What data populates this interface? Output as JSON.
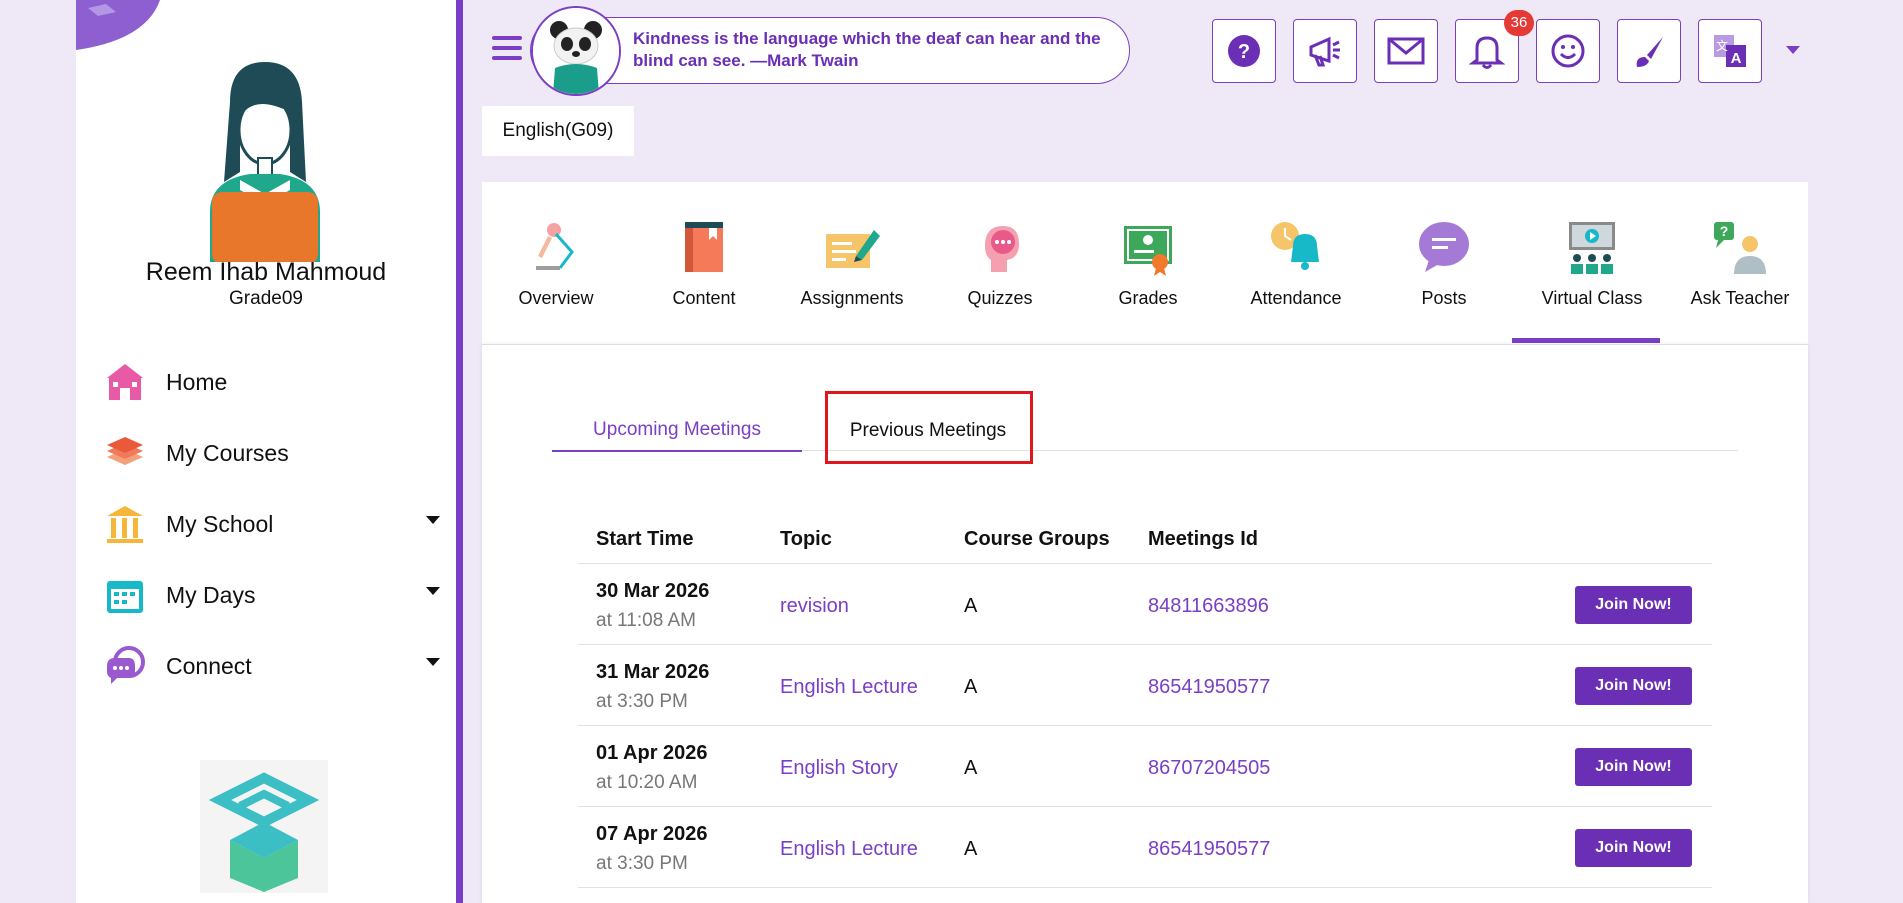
{
  "user": {
    "name": "Reem Ihab Mahmoud",
    "grade": "Grade09"
  },
  "sidebar": {
    "items": [
      {
        "label": "Home",
        "icon": "home-icon",
        "color": "#e85aa6",
        "has_caret": false
      },
      {
        "label": "My Courses",
        "icon": "courses-icon",
        "color": "#f07a5a",
        "has_caret": false
      },
      {
        "label": "My School",
        "icon": "school-icon",
        "color": "#f5b63a",
        "has_caret": true
      },
      {
        "label": "My Days",
        "icon": "calendar-icon",
        "color": "#17b8c8",
        "has_caret": true
      },
      {
        "label": "Connect",
        "icon": "connect-icon",
        "color": "#9b59d0",
        "has_caret": true
      }
    ]
  },
  "header": {
    "quote": "Kindness is the language which the deaf can hear and the blind can see. —Mark Twain",
    "notification_count": "36",
    "buttons": [
      "help-icon",
      "announcement-icon",
      "mail-icon",
      "bell-icon",
      "smiley-icon",
      "brush-icon",
      "translate-icon"
    ]
  },
  "course": {
    "label": "English(G09)"
  },
  "course_nav": {
    "items": [
      {
        "label": "Overview",
        "icon": "overview-icon"
      },
      {
        "label": "Content",
        "icon": "content-icon"
      },
      {
        "label": "Assignments",
        "icon": "assignments-icon"
      },
      {
        "label": "Quizzes",
        "icon": "quizzes-icon"
      },
      {
        "label": "Grades",
        "icon": "grades-icon"
      },
      {
        "label": "Attendance",
        "icon": "attendance-icon"
      },
      {
        "label": "Posts",
        "icon": "posts-icon"
      },
      {
        "label": "Virtual Class",
        "icon": "virtual-class-icon"
      },
      {
        "label": "Ask Teacher",
        "icon": "ask-teacher-icon"
      }
    ],
    "active": "Virtual Class"
  },
  "tabs": {
    "upcoming": "Upcoming Meetings",
    "previous": "Previous Meetings",
    "active": "Upcoming Meetings"
  },
  "table": {
    "headers": [
      "Start Time",
      "Topic",
      "Course Groups",
      "Meetings Id"
    ],
    "rows": [
      {
        "date": "30 Mar 2026",
        "time": "at 11:08 AM",
        "topic": "revision",
        "group": "A",
        "id": "84811663896",
        "action": "Join Now!"
      },
      {
        "date": "31 Mar 2026",
        "time": "at 3:30 PM",
        "topic": "English Lecture",
        "group": "A",
        "id": "86541950577",
        "action": "Join Now!"
      },
      {
        "date": "01 Apr 2026",
        "time": "at 10:20 AM",
        "topic": "English Story",
        "group": "A",
        "id": "86707204505",
        "action": "Join Now!"
      },
      {
        "date": "07 Apr 2026",
        "time": "at 3:30 PM",
        "topic": "English Lecture",
        "group": "A",
        "id": "86541950577",
        "action": "Join Now!"
      }
    ]
  },
  "colors": {
    "accent": "#7a3fc4",
    "background": "#efe8f7",
    "badge": "#e53935",
    "highlight": "#e0161d"
  }
}
